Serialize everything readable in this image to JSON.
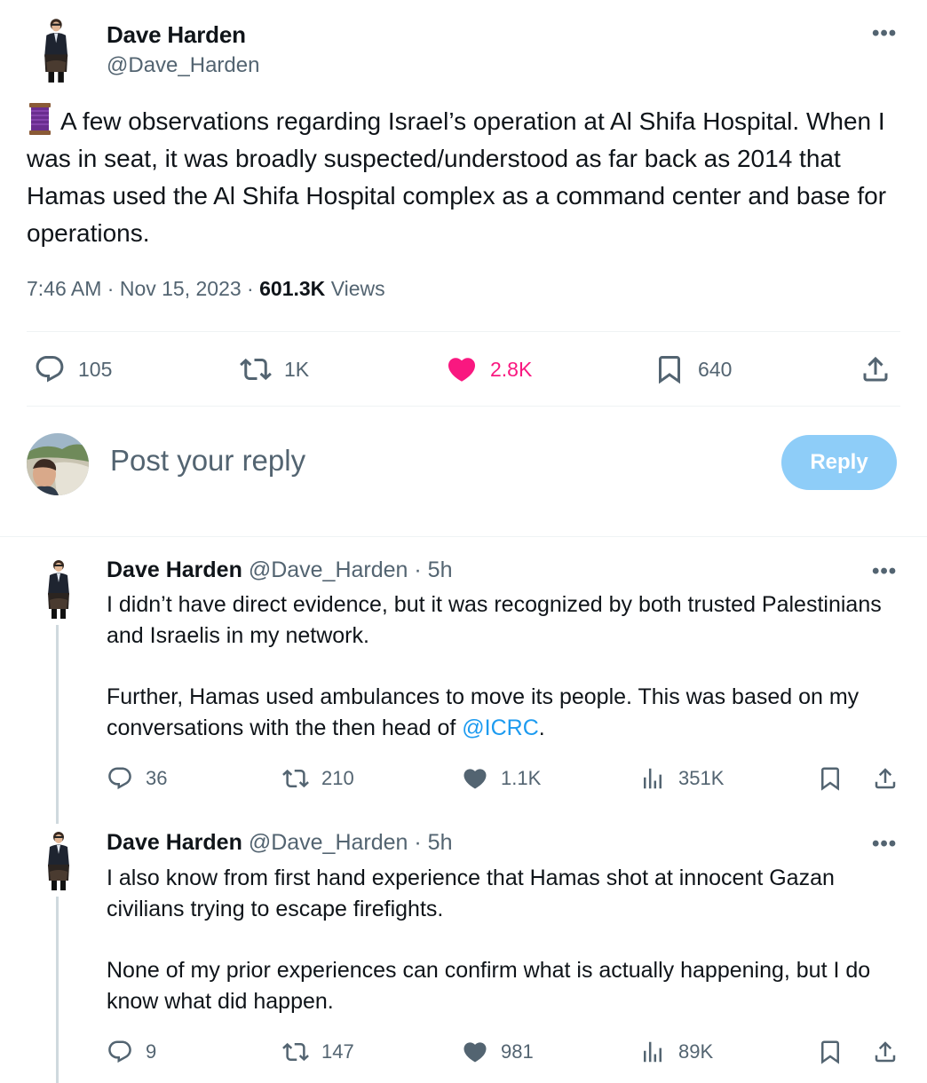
{
  "main_tweet": {
    "author_name": "Dave Harden",
    "author_handle": "@Dave_Harden",
    "text": "A few observations regarding Israel’s operation at Al Shifa Hospital. When I was in seat, it was broadly suspected/understood as far back as 2014 that Hamas used the Al Shifa Hospital complex as a command center and base for operations.",
    "lead_icon": "thread-spool-icon",
    "time": "7:46 AM",
    "date": "Nov 15, 2023",
    "views_count": "601.3K",
    "views_label": "Views",
    "actions": {
      "replies": "105",
      "reposts": "1K",
      "likes": "2.8K",
      "bookmarks": "640"
    }
  },
  "composer": {
    "placeholder": "Post your reply",
    "button_label": "Reply"
  },
  "replies": [
    {
      "author_name": "Dave Harden",
      "author_handle": "@Dave_Harden",
      "age": "5h",
      "paragraph1": "I didn’t have direct evidence, but it was recognized by both trusted Palestinians and Israelis in my network.",
      "paragraph2_prefix": "Further, Hamas used ambulances to move its people.  This was based on my conversations with the then head of ",
      "mention": "@ICRC",
      "paragraph2_suffix": ".",
      "actions": {
        "replies": "36",
        "reposts": "210",
        "likes": "1.1K",
        "views": "351K"
      }
    },
    {
      "author_name": "Dave Harden",
      "author_handle": "@Dave_Harden",
      "age": "5h",
      "paragraph1": "I also know from first hand experience that Hamas shot at innocent Gazan civilians trying to escape firefights.",
      "paragraph2": "None of my prior experiences can confirm what is actually happening, but I do know what did happen.",
      "actions": {
        "replies": "9",
        "reposts": "147",
        "likes": "981",
        "views": "89K"
      }
    }
  ],
  "colors": {
    "text": "#0f1419",
    "secondary": "#536471",
    "like": "#f91880",
    "link": "#1d9bf0",
    "reply_button": "#8ecdf8",
    "divider": "#eff3f4"
  }
}
